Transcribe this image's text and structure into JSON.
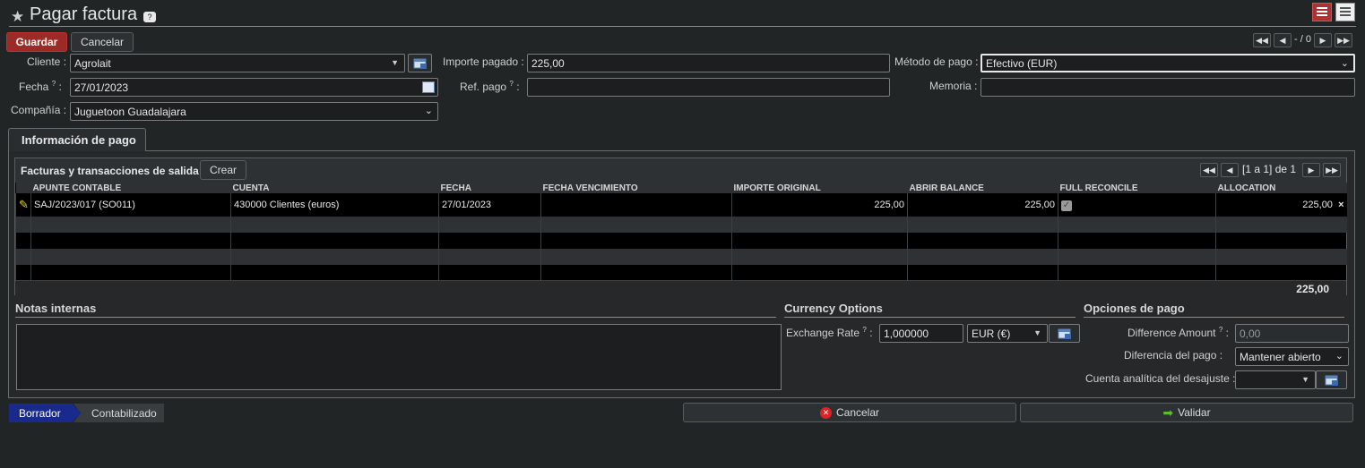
{
  "header": {
    "title": "Pagar factura",
    "help_glyph": "?",
    "icons": [
      "star-icon",
      "list-view-icon",
      "form-view-icon"
    ]
  },
  "toolbar": {
    "save_label": "Guardar",
    "cancel_label": "Cancelar",
    "pager_text": "- / 0"
  },
  "form": {
    "cliente_label": "Cliente :",
    "cliente_value": "Agrolait",
    "fecha_label": "Fecha",
    "fecha_value": "27/01/2023",
    "compania_label": "Compañía :",
    "compania_value": "Juguetoon Guadalajara",
    "importe_label": "Importe pagado :",
    "importe_value": "225,00",
    "ref_label": "Ref. pago",
    "ref_value": "",
    "metodo_label": "Método de pago :",
    "metodo_value": "Efectivo (EUR)",
    "memoria_label": "Memoria :",
    "memoria_value": "",
    "help_mark": "?",
    "colon": ":"
  },
  "notebook": {
    "tab_label": "Información de pago"
  },
  "grid": {
    "title": "Facturas y transacciones de salida",
    "create_label": "Crear",
    "pager_text": "[1 a 1] de 1",
    "columns": [
      "Apunte contable",
      "Cuenta",
      "Fecha",
      "Fecha vencimiento",
      "Importe original",
      "Abrir balance",
      "Full reconcile",
      "Allocation"
    ],
    "rows": [
      {
        "apunte": "SAJ/2023/017 (SO011)",
        "cuenta": "430000 Clientes (euros)",
        "fecha": "27/01/2023",
        "vencimiento": "",
        "importe_original": "225,00",
        "abrir_balance": "225,00",
        "full_reconcile": true,
        "allocation": "225,00",
        "delete_glyph": "×"
      }
    ],
    "total": "225,00"
  },
  "notes": {
    "title": "Notas internas",
    "value": ""
  },
  "currency": {
    "title": "Currency Options",
    "rate_label": "Exchange Rate",
    "rate_value": "1,000000",
    "currency_value": "EUR (€)"
  },
  "payment_options": {
    "title": "Opciones de pago",
    "diff_amount_label": "Difference Amount",
    "diff_amount_value": "0,00",
    "diff_pago_label": "Diferencia del pago :",
    "diff_pago_value": "Mantener abierto",
    "cuenta_label": "Cuenta analítica del desajuste :",
    "cuenta_value": ""
  },
  "status": {
    "draft": "Borrador",
    "posted": "Contabilizado"
  },
  "footer": {
    "cancel_label": "Cancelar",
    "validate_label": "Validar"
  },
  "colors": {
    "accent_red": "#9c2a26",
    "status_blue": "#1a2a8c",
    "background": "#222526"
  }
}
